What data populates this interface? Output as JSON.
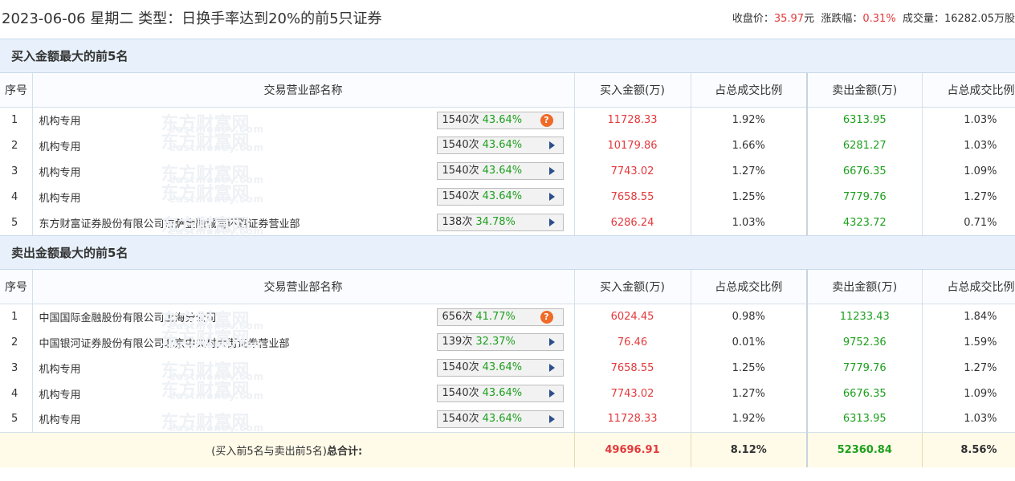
{
  "header": {
    "date": "2023-06-06",
    "weekday": "星期二",
    "type_label": "类型：",
    "type_value": "日换手率达到20%的前5只证券",
    "close_label": "收盘价：",
    "close_value": "35.97",
    "close_unit": "元",
    "change_label": "涨跌幅：",
    "change_value": "0.31%",
    "volume_label": "成交量：",
    "volume_value": "16282.05万股"
  },
  "watermark": {
    "cn": "东方财富网",
    "en": "eastmoney.com"
  },
  "columns": [
    "序号",
    "交易营业部名称",
    "买入金额(万)",
    "占总成交比例",
    "卖出金额(万)",
    "占总成交比例"
  ],
  "buy_section": {
    "title": "买入金额最大的前5名",
    "rows": [
      {
        "idx": "1",
        "name": "机构专用",
        "count": "1540次",
        "rate": "43.64%",
        "icon": "warning-icon",
        "buy": "11728.33",
        "buy_pct": "1.92%",
        "sell": "6313.95",
        "sell_pct": "1.03%"
      },
      {
        "idx": "2",
        "name": "机构专用",
        "count": "1540次",
        "rate": "43.64%",
        "icon": "arrow-right-icon",
        "buy": "10179.86",
        "buy_pct": "1.66%",
        "sell": "6281.27",
        "sell_pct": "1.03%"
      },
      {
        "idx": "3",
        "name": "机构专用",
        "count": "1540次",
        "rate": "43.64%",
        "icon": "arrow-right-icon",
        "buy": "7743.02",
        "buy_pct": "1.27%",
        "sell": "6676.35",
        "sell_pct": "1.09%"
      },
      {
        "idx": "4",
        "name": "机构专用",
        "count": "1540次",
        "rate": "43.64%",
        "icon": "arrow-right-icon",
        "buy": "7658.55",
        "buy_pct": "1.25%",
        "sell": "7779.76",
        "sell_pct": "1.27%"
      },
      {
        "idx": "5",
        "name": "东方财富证券股份有限公司拉萨金融城南环路证券营业部",
        "count": "138次",
        "rate": "34.78%",
        "icon": "arrow-right-icon",
        "buy": "6286.24",
        "buy_pct": "1.03%",
        "sell": "4323.72",
        "sell_pct": "0.71%"
      }
    ]
  },
  "sell_section": {
    "title": "卖出金额最大的前5名",
    "rows": [
      {
        "idx": "1",
        "name": "中国国际金融股份有限公司上海分公司",
        "count": "656次",
        "rate": "41.77%",
        "icon": "warning-icon",
        "buy": "6024.45",
        "buy_pct": "0.98%",
        "sell": "11233.43",
        "sell_pct": "1.84%"
      },
      {
        "idx": "2",
        "name": "中国银河证券股份有限公司北京中关村大街证券营业部",
        "count": "139次",
        "rate": "32.37%",
        "icon": "arrow-right-icon",
        "buy": "76.46",
        "buy_pct": "0.01%",
        "sell": "9752.36",
        "sell_pct": "1.59%"
      },
      {
        "idx": "3",
        "name": "机构专用",
        "count": "1540次",
        "rate": "43.64%",
        "icon": "arrow-right-icon",
        "buy": "7658.55",
        "buy_pct": "1.25%",
        "sell": "7779.76",
        "sell_pct": "1.27%"
      },
      {
        "idx": "4",
        "name": "机构专用",
        "count": "1540次",
        "rate": "43.64%",
        "icon": "arrow-right-icon",
        "buy": "7743.02",
        "buy_pct": "1.27%",
        "sell": "6676.35",
        "sell_pct": "1.09%"
      },
      {
        "idx": "5",
        "name": "机构专用",
        "count": "1540次",
        "rate": "43.64%",
        "icon": "arrow-right-icon",
        "buy": "11728.33",
        "buy_pct": "1.92%",
        "sell": "6313.95",
        "sell_pct": "1.03%"
      }
    ]
  },
  "total": {
    "label_prefix": "(买入前5名与卖出前5名)",
    "label_bold": "总合计:",
    "buy": "49696.91",
    "buy_pct": "8.12%",
    "sell": "52360.84",
    "sell_pct": "8.56%"
  },
  "colors": {
    "red": "#e4393c",
    "green": "#1ea01e",
    "section_bg": "#e8f1fb",
    "total_bg": "#fffbe8"
  }
}
